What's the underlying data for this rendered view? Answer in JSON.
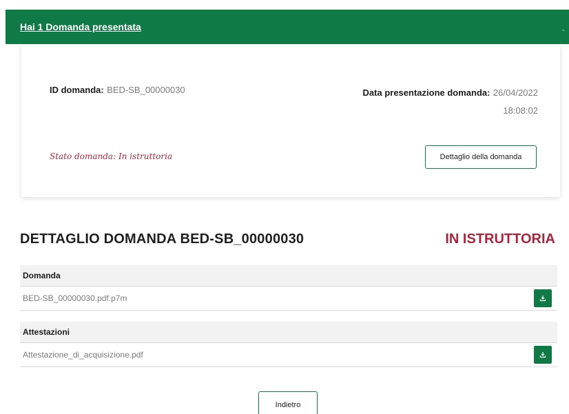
{
  "accordion": {
    "title": "Hai 1 Domanda presentata",
    "chevron_icon": "chevron-up-icon"
  },
  "summary": {
    "id_label": "ID domanda:",
    "id_value": "BED-SB_00000030",
    "date_label": "Data presentazione domanda:",
    "date_value": "26/04/2022",
    "time_value": "18:08:02",
    "stato_label": "Stato domanda:",
    "stato_value": "In istruttoria",
    "detail_button": "Dettaglio della domanda"
  },
  "detail": {
    "title": "DETTAGLIO DOMANDA BED-SB_00000030",
    "status": "IN ISTRUTTORIA"
  },
  "table": {
    "sections": [
      {
        "header": "Domanda",
        "file": "BED-SB_00000030.pdf.p7m",
        "action_icon": "download-icon"
      },
      {
        "header": "Attestazioni",
        "file": "Attestazione_di_acquisizione.pdf",
        "action_icon": "download-icon"
      }
    ]
  },
  "footer": {
    "back_button": "Indietro"
  },
  "colors": {
    "brand_green": "#0f7a45",
    "status_red": "#a8263c"
  }
}
